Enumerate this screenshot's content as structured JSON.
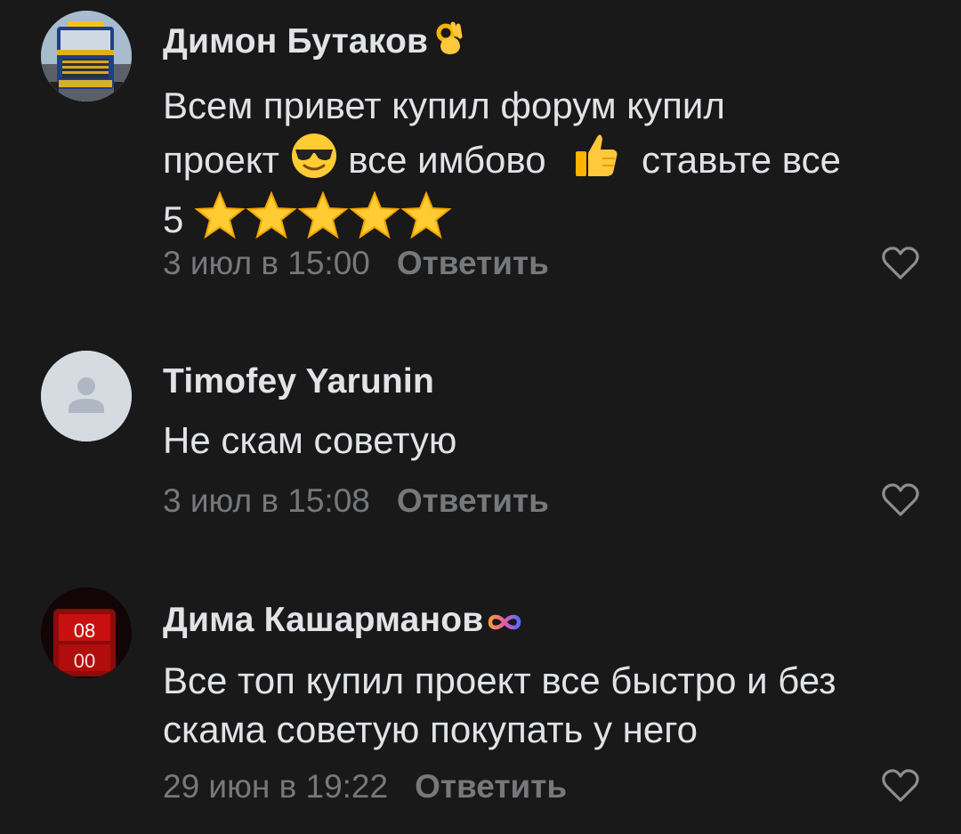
{
  "comments": [
    {
      "author": "Димон Бутаков",
      "author_badge_icon": "ok-hand-emoji",
      "text_line1": "Всем привет купил форум купил",
      "text_line2_a": "проект",
      "text_line2_b": "все имбово",
      "text_line2_c": "ставьте все",
      "text_line3": "5",
      "time": "3 июл в 15:00",
      "reply_label": "Ответить",
      "avatar": "truck-photo"
    },
    {
      "author": "Timofey Yarunin",
      "text": "Не скам советую",
      "time": "3 июл в 15:08",
      "reply_label": "Ответить",
      "avatar": "default-user-icon"
    },
    {
      "author": "Дима Кашарманов",
      "author_badge_icon": "infinity-icon",
      "text_line1": "Все топ купил проект все быстро и без",
      "text_line2": "скама советую покупать у него",
      "time": "29 июн в 19:22",
      "reply_label": "Ответить",
      "avatar_text_top": "08",
      "avatar_text_bottom": "00"
    }
  ],
  "colors": {
    "background": "#19191a",
    "text_primary": "#e1e3e6",
    "text_secondary": "#76787a",
    "avatar_placeholder": "#d6dbe1"
  }
}
